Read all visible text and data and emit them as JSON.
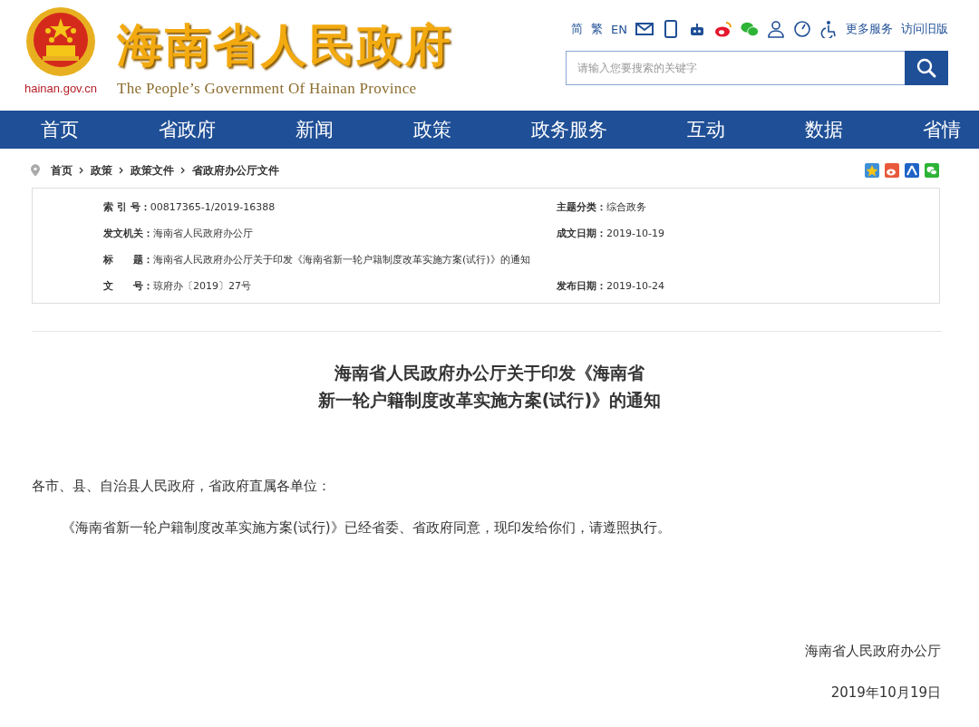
{
  "header": {
    "site_domain": "hainan.gov.cn",
    "site_title": "海南省人民政府",
    "site_subtitle": "The People’s Government Of Hainan Province",
    "lang_links": [
      "简",
      "繁",
      "EN"
    ],
    "service_links": [
      "更多服务",
      "访问旧版"
    ],
    "search": {
      "placeholder": "请输入您要搜索的关键字"
    }
  },
  "nav": [
    "首页",
    "省政府",
    "新闻",
    "政策",
    "政务服务",
    "互动",
    "数据",
    "省情"
  ],
  "breadcrumb": [
    "首页",
    "政策",
    "政策文件",
    "省政府办公厅文件"
  ],
  "info_rows": [
    [
      {
        "label": "索 引 号：",
        "value": "00817365-1/2019-16388"
      },
      {
        "label": "主题分类：",
        "value": "综合政务"
      }
    ],
    [
      {
        "label": "发文机关：",
        "value": "海南省人民政府办公厅"
      },
      {
        "label": "成文日期：",
        "value": "2019-10-19"
      }
    ],
    [
      {
        "label": "标　　题：",
        "value": "海南省人民政府办公厅关于印发《海南省新一轮户籍制度改革实施方案(试行)》的通知"
      }
    ],
    [
      {
        "label": "文　　号：",
        "value": "琼府办〔2019〕27号"
      },
      {
        "label": "发布日期：",
        "value": "2019-10-24"
      }
    ]
  ],
  "article": {
    "title_lines": [
      "海南省人民政府办公厅关于印发《海南省",
      "新一轮户籍制度改革实施方案(试行)》的通知"
    ],
    "salutation": "各市、县、自治县人民政府，省政府直属各单位：",
    "body": "《海南省新一轮户籍制度改革实施方案(试行)》已经省委、省政府同意，现印发给你们，请遵照执行。",
    "signature": "海南省人民政府办公厅",
    "date": "2019年10月19日"
  }
}
